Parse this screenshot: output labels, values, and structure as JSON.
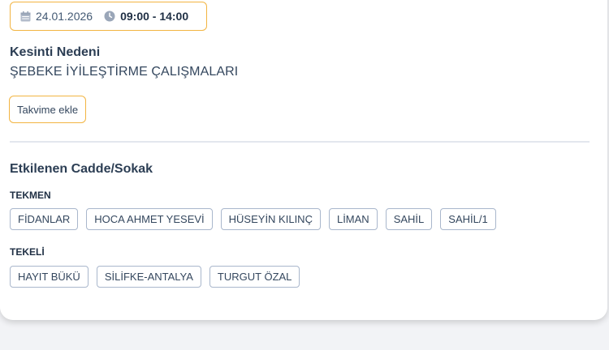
{
  "outage": {
    "date": "24.01.2026",
    "time": "09:00 - 14:00",
    "reason_label": "Kesinti Nedeni",
    "reason_value": "ŞEBEKE İYİLEŞTİRME ÇALIŞMALARI",
    "add_to_calendar_label": "Takvime ekle",
    "icons": {
      "date": "calendar-icon",
      "time": "clock-icon"
    }
  },
  "affected": {
    "title": "Etkilenen Cadde/Sokak",
    "districts": [
      {
        "name": "TEKMEN",
        "streets": [
          "FİDANLAR",
          "HOCA AHMET YESEVİ",
          "HÜSEYİN KILINÇ",
          "LİMAN",
          "SAHİL",
          "SAHİL/1"
        ]
      },
      {
        "name": "TEKELİ",
        "streets": [
          "HAYIT BÜKÜ",
          "SİLİFKE-ANTALYA",
          "TURGUT ÖZAL"
        ]
      }
    ]
  },
  "colors": {
    "accent_border": "#f2b441",
    "tag_border": "#a9b7cc",
    "text": "#2c3e54"
  }
}
